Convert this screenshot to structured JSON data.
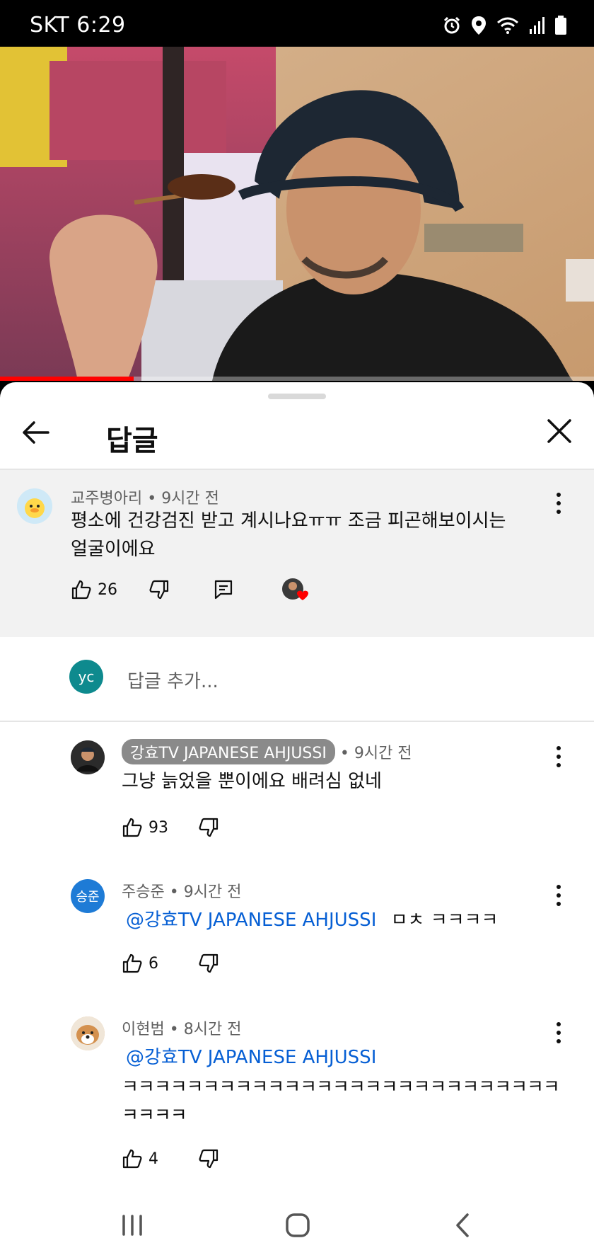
{
  "status_bar": {
    "carrier_time": "SKT 6:29",
    "icons": [
      "alarm-icon",
      "location-icon",
      "wifi-icon",
      "signal-icon",
      "battery-icon"
    ]
  },
  "video": {
    "progress_fraction": 0.225,
    "progress_color": "#ff0000"
  },
  "sheet": {
    "title": "답글"
  },
  "parent_comment": {
    "author": "교주병아리",
    "time": "9시간 전",
    "text_line1": "평소에 건강검진 받고 계시나요ㅠㅠ 조금 피곤해보이시는",
    "text_line2": "얼굴이에요",
    "likes": "26"
  },
  "reply_input": {
    "avatar_initials": "yc",
    "placeholder": "답글 추가..."
  },
  "replies": [
    {
      "author": "강효TV JAPANESE AHJUSSI",
      "time": "9시간 전",
      "text": "그냥 늙었을 뿐이에요 배려심 없네",
      "likes": "93"
    },
    {
      "author": "주승준",
      "avatar_initials": "승준",
      "time": "9시간 전",
      "mention": "@강효TV JAPANESE AHJUSSI",
      "text": "ㅁㅊ ㅋㅋㅋㅋ",
      "likes": "6"
    },
    {
      "author": "이현범",
      "time": "8시간 전",
      "mention": "@강효TV JAPANESE AHJUSSI",
      "text_line1": "ㅋㅋㅋㅋㅋㅋㅋㅋㅋㅋㅋㅋㅋㅋㅋㅋㅋㅋㅋㅋㅋㅋㅋㅋㅋㅋㅋ",
      "text_line2": "ㅋㅋㅋㅋ",
      "likes": "4"
    }
  ],
  "separator": "•",
  "nav_bar": {
    "icons": [
      "recent-apps-icon",
      "home-icon",
      "back-icon"
    ]
  },
  "colors": {
    "accent_mention": "#065fd4",
    "highlight_bg": "#f2f2f2",
    "channel_pill": "#8a8a8a",
    "input_avatar": "#0e8a8e",
    "reply_avatar": "#1e7bd6"
  }
}
